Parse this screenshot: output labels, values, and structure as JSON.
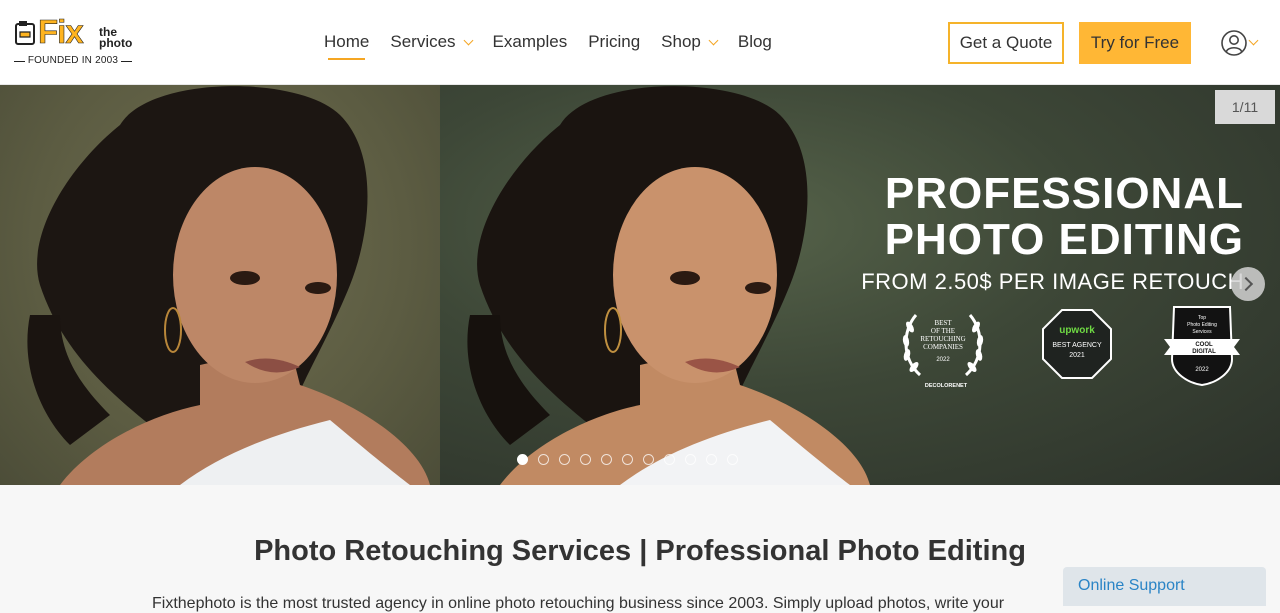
{
  "logo": {
    "word": "Fix",
    "the": "the",
    "photo": "photo",
    "founded": "FOUNDED IN 2003"
  },
  "nav": {
    "items": [
      {
        "label": "Home",
        "active": true,
        "dropdown": false
      },
      {
        "label": "Services",
        "active": false,
        "dropdown": true
      },
      {
        "label": "Examples",
        "active": false,
        "dropdown": false
      },
      {
        "label": "Pricing",
        "active": false,
        "dropdown": false
      },
      {
        "label": "Shop",
        "active": false,
        "dropdown": true
      },
      {
        "label": "Blog",
        "active": false,
        "dropdown": false
      }
    ]
  },
  "header": {
    "quote_label": "Get a Quote",
    "free_label": "Try for Free",
    "accent_color": "#f5a623"
  },
  "hero": {
    "counter": "1/11",
    "headline_line1": "PROFESSIONAL",
    "headline_line2": "PHOTO EDITING",
    "subline": "FROM 2.50$ PER IMAGE RETOUCH",
    "slides_total": 11,
    "active_slide": 1,
    "badges": {
      "badge1": {
        "line1": "BEST",
        "line2": "OF THE",
        "line3": "RETOUCHING",
        "line4": "COMPANIES",
        "year": "2022",
        "brand": "DECOLORENET"
      },
      "badge2": {
        "brand": "upwork",
        "line1": "BEST AGENCY",
        "year": "2021"
      },
      "badge3": {
        "line1": "Top",
        "line2": "Photo Editing",
        "line3": "Services",
        "brand1": "COOL",
        "brand2": "DIGITAL",
        "year": "2022"
      }
    }
  },
  "content": {
    "title": "Photo Retouching Services | Professional Photo Editing",
    "intro": "Fixthephoto is the most trusted agency in online photo retouching business since 2003. Simply upload photos, write your"
  },
  "support": {
    "label": "Online Support"
  }
}
